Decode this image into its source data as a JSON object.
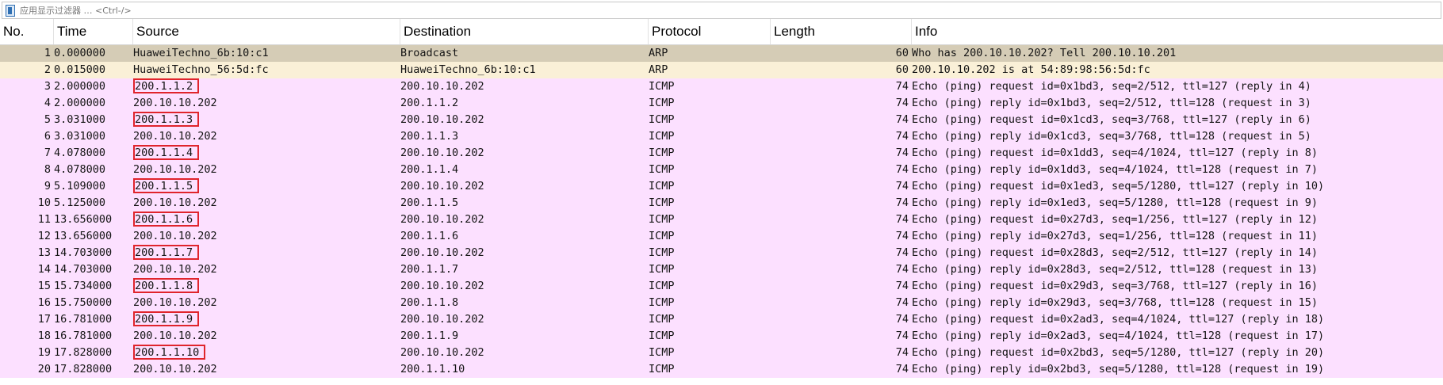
{
  "filter": {
    "placeholder": "应用显示过滤器 … <Ctrl-/>"
  },
  "columns": [
    "No.",
    "Time",
    "Source",
    "Destination",
    "Protocol",
    "Length",
    "Info"
  ],
  "colors": {
    "arp_selected_row": "#d5ccb6",
    "arp_row": "#faf0d7",
    "icmp_row": "#fce0ff",
    "highlight_box": "#e0242c"
  },
  "packets": [
    {
      "no": "1",
      "time": "0.000000",
      "source": "HuaweiTechno_6b:10:c1",
      "destination": "Broadcast",
      "protocol": "ARP",
      "length": "60",
      "info": "Who has 200.10.10.202? Tell 200.10.10.201",
      "color_key": "arp_selected_row",
      "highlight": false
    },
    {
      "no": "2",
      "time": "0.015000",
      "source": "HuaweiTechno_56:5d:fc",
      "destination": "HuaweiTechno_6b:10:c1",
      "protocol": "ARP",
      "length": "60",
      "info": "200.10.10.202 is at 54:89:98:56:5d:fc",
      "color_key": "arp_row",
      "highlight": false
    },
    {
      "no": "3",
      "time": "2.000000",
      "source": "200.1.1.2",
      "destination": "200.10.10.202",
      "protocol": "ICMP",
      "length": "74",
      "info": "Echo (ping) request  id=0x1bd3, seq=2/512, ttl=127 (reply in 4)",
      "color_key": "icmp_row",
      "highlight": true
    },
    {
      "no": "4",
      "time": "2.000000",
      "source": "200.10.10.202",
      "destination": "200.1.1.2",
      "protocol": "ICMP",
      "length": "74",
      "info": "Echo (ping) reply    id=0x1bd3, seq=2/512, ttl=128 (request in 3)",
      "color_key": "icmp_row",
      "highlight": false
    },
    {
      "no": "5",
      "time": "3.031000",
      "source": "200.1.1.3",
      "destination": "200.10.10.202",
      "protocol": "ICMP",
      "length": "74",
      "info": "Echo (ping) request  id=0x1cd3, seq=3/768, ttl=127 (reply in 6)",
      "color_key": "icmp_row",
      "highlight": true
    },
    {
      "no": "6",
      "time": "3.031000",
      "source": "200.10.10.202",
      "destination": "200.1.1.3",
      "protocol": "ICMP",
      "length": "74",
      "info": "Echo (ping) reply    id=0x1cd3, seq=3/768, ttl=128 (request in 5)",
      "color_key": "icmp_row",
      "highlight": false
    },
    {
      "no": "7",
      "time": "4.078000",
      "source": "200.1.1.4",
      "destination": "200.10.10.202",
      "protocol": "ICMP",
      "length": "74",
      "info": "Echo (ping) request  id=0x1dd3, seq=4/1024, ttl=127 (reply in 8)",
      "color_key": "icmp_row",
      "highlight": true
    },
    {
      "no": "8",
      "time": "4.078000",
      "source": "200.10.10.202",
      "destination": "200.1.1.4",
      "protocol": "ICMP",
      "length": "74",
      "info": "Echo (ping) reply    id=0x1dd3, seq=4/1024, ttl=128 (request in 7)",
      "color_key": "icmp_row",
      "highlight": false
    },
    {
      "no": "9",
      "time": "5.109000",
      "source": "200.1.1.5",
      "destination": "200.10.10.202",
      "protocol": "ICMP",
      "length": "74",
      "info": "Echo (ping) request  id=0x1ed3, seq=5/1280, ttl=127 (reply in 10)",
      "color_key": "icmp_row",
      "highlight": true
    },
    {
      "no": "10",
      "time": "5.125000",
      "source": "200.10.10.202",
      "destination": "200.1.1.5",
      "protocol": "ICMP",
      "length": "74",
      "info": "Echo (ping) reply    id=0x1ed3, seq=5/1280, ttl=128 (request in 9)",
      "color_key": "icmp_row",
      "highlight": false
    },
    {
      "no": "11",
      "time": "13.656000",
      "source": "200.1.1.6",
      "destination": "200.10.10.202",
      "protocol": "ICMP",
      "length": "74",
      "info": "Echo (ping) request  id=0x27d3, seq=1/256, ttl=127 (reply in 12)",
      "color_key": "icmp_row",
      "highlight": true
    },
    {
      "no": "12",
      "time": "13.656000",
      "source": "200.10.10.202",
      "destination": "200.1.1.6",
      "protocol": "ICMP",
      "length": "74",
      "info": "Echo (ping) reply    id=0x27d3, seq=1/256, ttl=128 (request in 11)",
      "color_key": "icmp_row",
      "highlight": false
    },
    {
      "no": "13",
      "time": "14.703000",
      "source": "200.1.1.7",
      "destination": "200.10.10.202",
      "protocol": "ICMP",
      "length": "74",
      "info": "Echo (ping) request  id=0x28d3, seq=2/512, ttl=127 (reply in 14)",
      "color_key": "icmp_row",
      "highlight": true
    },
    {
      "no": "14",
      "time": "14.703000",
      "source": "200.10.10.202",
      "destination": "200.1.1.7",
      "protocol": "ICMP",
      "length": "74",
      "info": "Echo (ping) reply    id=0x28d3, seq=2/512, ttl=128 (request in 13)",
      "color_key": "icmp_row",
      "highlight": false
    },
    {
      "no": "15",
      "time": "15.734000",
      "source": "200.1.1.8",
      "destination": "200.10.10.202",
      "protocol": "ICMP",
      "length": "74",
      "info": "Echo (ping) request  id=0x29d3, seq=3/768, ttl=127 (reply in 16)",
      "color_key": "icmp_row",
      "highlight": true
    },
    {
      "no": "16",
      "time": "15.750000",
      "source": "200.10.10.202",
      "destination": "200.1.1.8",
      "protocol": "ICMP",
      "length": "74",
      "info": "Echo (ping) reply    id=0x29d3, seq=3/768, ttl=128 (request in 15)",
      "color_key": "icmp_row",
      "highlight": false
    },
    {
      "no": "17",
      "time": "16.781000",
      "source": "200.1.1.9",
      "destination": "200.10.10.202",
      "protocol": "ICMP",
      "length": "74",
      "info": "Echo (ping) request  id=0x2ad3, seq=4/1024, ttl=127 (reply in 18)",
      "color_key": "icmp_row",
      "highlight": true
    },
    {
      "no": "18",
      "time": "16.781000",
      "source": "200.10.10.202",
      "destination": "200.1.1.9",
      "protocol": "ICMP",
      "length": "74",
      "info": "Echo (ping) reply    id=0x2ad3, seq=4/1024, ttl=128 (request in 17)",
      "color_key": "icmp_row",
      "highlight": false
    },
    {
      "no": "19",
      "time": "17.828000",
      "source": "200.1.1.10",
      "destination": "200.10.10.202",
      "protocol": "ICMP",
      "length": "74",
      "info": "Echo (ping) request  id=0x2bd3, seq=5/1280, ttl=127 (reply in 20)",
      "color_key": "icmp_row",
      "highlight": true
    },
    {
      "no": "20",
      "time": "17.828000",
      "source": "200.10.10.202",
      "destination": "200.1.1.10",
      "protocol": "ICMP",
      "length": "74",
      "info": "Echo (ping) reply    id=0x2bd3, seq=5/1280, ttl=128 (request in 19)",
      "color_key": "icmp_row",
      "highlight": false
    }
  ]
}
